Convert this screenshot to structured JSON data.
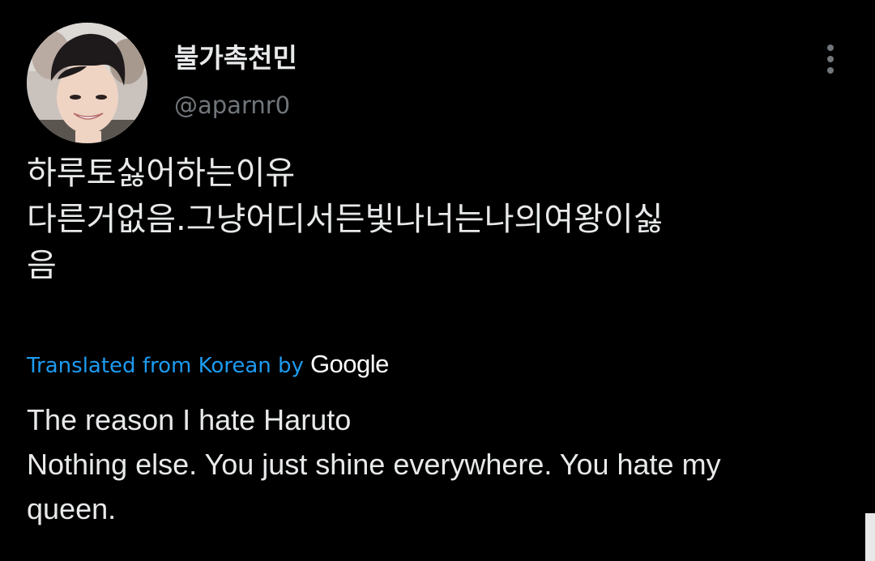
{
  "tweet": {
    "author": {
      "display_name": "불가촉천민",
      "handle": "@aparnr0",
      "avatar_icon": "user-avatar-photo"
    },
    "more_icon": "more-vertical-icon",
    "original_lines": [
      "하루토싫어하는이유",
      "다른거없음.그냥어디서든빛나너는나의여왕이싫",
      "음"
    ],
    "translation": {
      "attribution": "Translated from Korean by",
      "provider": "Google",
      "lines": [
        "The reason I hate Haruto",
        "Nothing else. You just shine everywhere. You hate my",
        "queen."
      ]
    }
  },
  "colors": {
    "background": "#000000",
    "primary_text": "#e7e9ea",
    "secondary_text": "#71767b",
    "link": "#1d9bf0"
  }
}
